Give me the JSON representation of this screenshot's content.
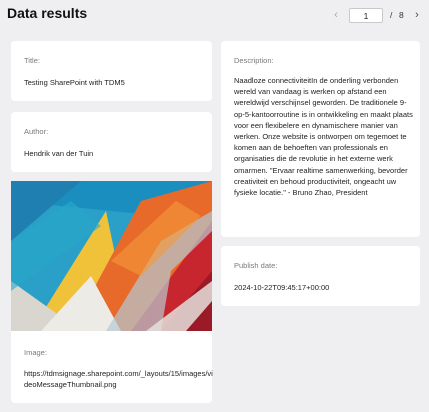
{
  "header": {
    "title": "Data results"
  },
  "pager": {
    "current_page": "1",
    "separator": "/",
    "total_pages": "8"
  },
  "fields": {
    "title": {
      "label": "Title:",
      "value": "Testing SharePoint with TDM5"
    },
    "author": {
      "label": "Author:",
      "value": "Hendrik van der Tuin"
    },
    "image": {
      "label": "Image:",
      "value": "https://tdmsignage.sharepoint.com/_layouts/15/images/videoMessageThumbnail.png"
    },
    "description": {
      "label": "Description:",
      "value": "Naadloze connectiviteitIn de onderling verbonden wereld van vandaag is werken op afstand een wereldwijd verschijnsel geworden. De traditionele 9-op-5-kantoorroutine is in ontwikkeling en maakt plaats voor een flexibelere en dynamischere manier van werken. Onze website is ontworpen om tegemoet te komen aan de behoeften van professionals en organisaties die de revolutie in het externe werk omarmen. \"Ervaar realtime samenwerking, bevorder creativiteit en behoud productiviteit, ongeacht uw fysieke locatie.\" - Bruno Zhao, President"
    },
    "publish_date": {
      "label": "Publish date:",
      "value": "2024-10-22T09:45:17+00:00"
    }
  }
}
